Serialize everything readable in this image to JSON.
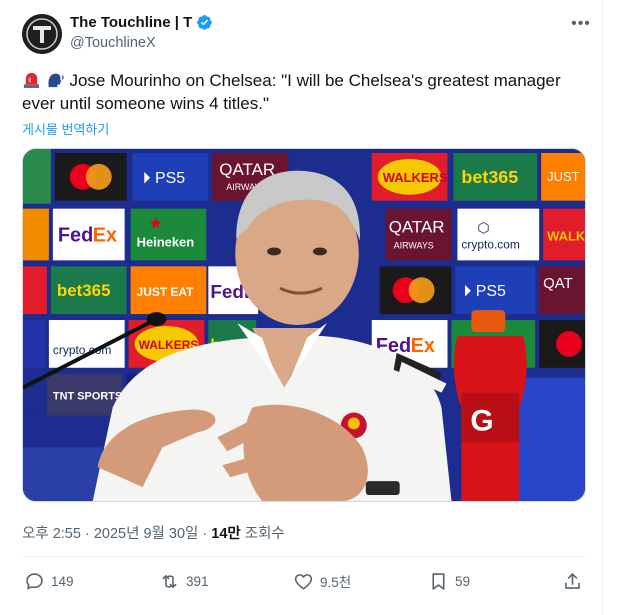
{
  "account": {
    "display_name": "The Touchline | T",
    "handle": "@TouchlineX",
    "avatar_letter": "T",
    "verified": true
  },
  "tweet": {
    "emojis": [
      "rotating-light-icon",
      "speaking-head-icon"
    ],
    "text": "Jose Mourinho on Chelsea: \"I will be Chelsea's greatest manager ever until someone wins 4 titles.\"",
    "translate_label": "게시물 번역하기"
  },
  "media": {
    "backdrop_sponsors": [
      "mastercard",
      "PS5",
      "QATAR AIRWAYS",
      "WALKERS",
      "bet365",
      "JUST EAT",
      "FedEx",
      "Heineken",
      "crypto.com",
      "TNT SPORTS"
    ],
    "shirt_badge": "Benfica"
  },
  "meta": {
    "time": "오후 2:55",
    "date": "2025년 9월 30일",
    "views_count": "14만",
    "views_label": "조회수"
  },
  "actions": {
    "replies": "149",
    "reposts": "391",
    "likes": "9.5천",
    "bookmarks": "59"
  },
  "colors": {
    "link_blue": "#1d9bf0",
    "secondary_text": "#536471",
    "primary_text": "#0f1419",
    "verified_blue": "#1d9bf0"
  }
}
